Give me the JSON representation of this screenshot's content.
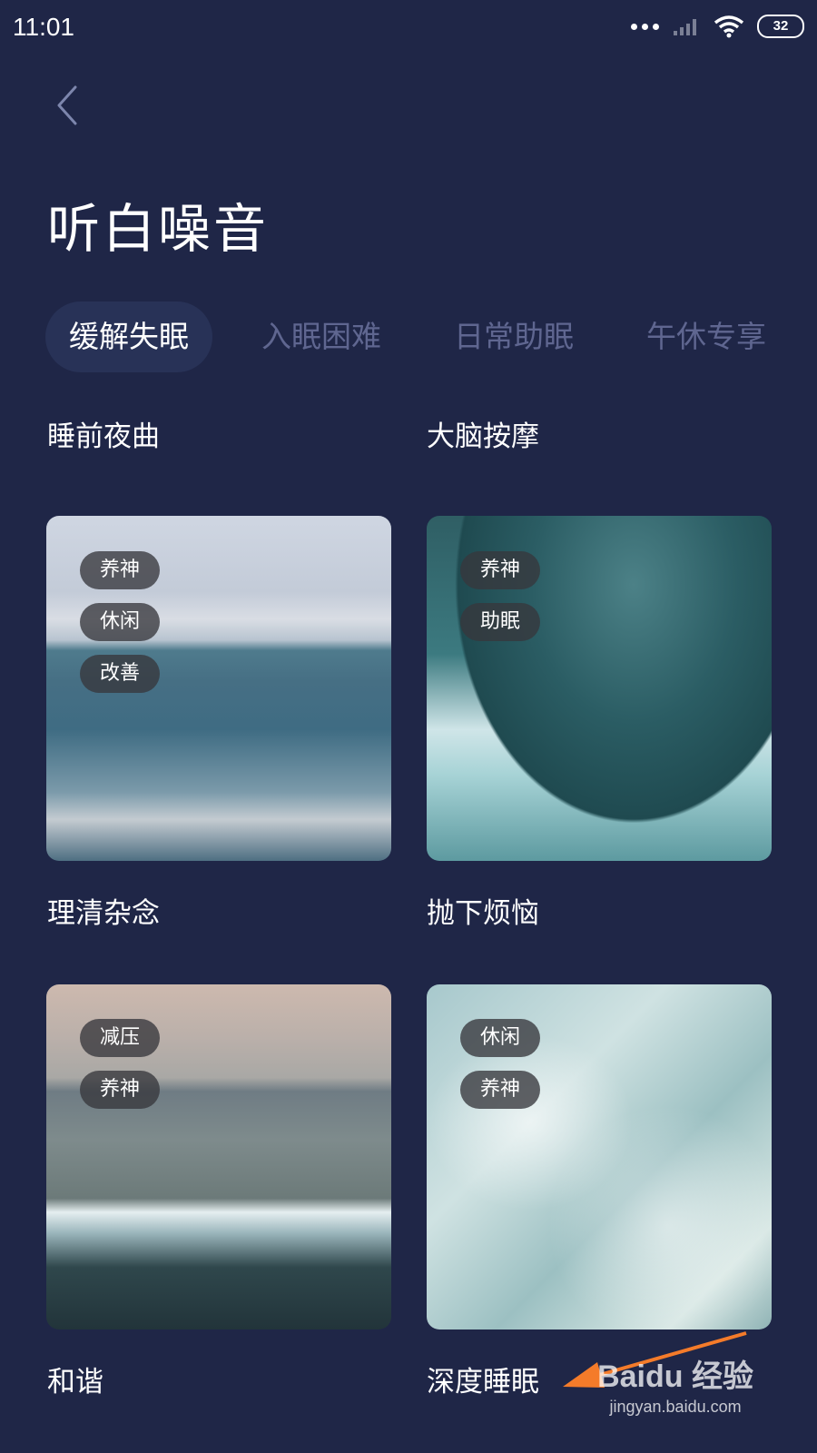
{
  "status_bar": {
    "time": "11:01",
    "battery": "32"
  },
  "page": {
    "title": "听白噪音"
  },
  "tabs": [
    {
      "label": "缓解失眠",
      "active": true
    },
    {
      "label": "入眠困难",
      "active": false
    },
    {
      "label": "日常助眠",
      "active": false
    },
    {
      "label": "午休专享",
      "active": false
    }
  ],
  "cards": [
    {
      "title": "睡前夜曲",
      "tags": [
        "养神",
        "休闲",
        "改善"
      ]
    },
    {
      "title": "大脑按摩",
      "tags": [
        "养神",
        "助眠"
      ]
    },
    {
      "title": "理清杂念",
      "tags": [
        "减压",
        "养神"
      ]
    },
    {
      "title": "抛下烦恼",
      "tags": [
        "休闲",
        "养神"
      ]
    },
    {
      "title": "和谐",
      "tags": []
    },
    {
      "title": "深度睡眠",
      "tags": []
    }
  ],
  "watermark": {
    "brand": "Baidu 经验",
    "url": "jingyan.baidu.com"
  },
  "annotation": {
    "color": "#f47b2a"
  }
}
